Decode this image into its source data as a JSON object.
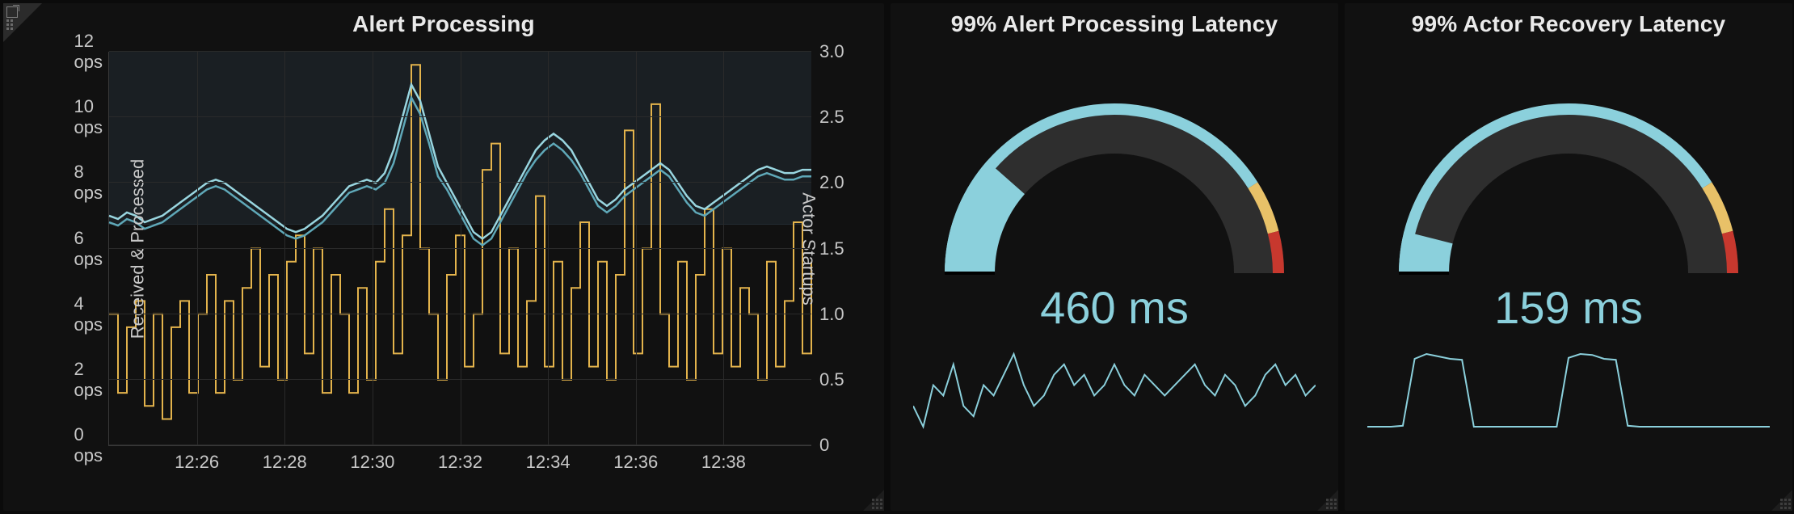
{
  "panels": {
    "alert_processing": {
      "title": "Alert Processing",
      "y_left_label": "Received & Processed",
      "y_right_label": "Actor Startups",
      "y_left_ticks": [
        "0 ops",
        "2 ops",
        "4 ops",
        "6 ops",
        "8 ops",
        "10 ops",
        "12 ops"
      ],
      "y_right_ticks": [
        "0",
        "0.5",
        "1.0",
        "1.5",
        "2.0",
        "2.5",
        "3.0"
      ],
      "x_ticks": [
        "12:26",
        "12:28",
        "12:30",
        "12:32",
        "12:34",
        "12:36",
        "12:38"
      ]
    },
    "alert_latency": {
      "title": "99% Alert Processing Latency",
      "value": "460 ms"
    },
    "recovery_latency": {
      "title": "99% Actor Recovery Latency",
      "value": "159 ms"
    }
  },
  "colors": {
    "gauge_fill": "#8bd0dc",
    "gauge_track": "#2e2e2e",
    "gauge_yellow": "#e8c168",
    "gauge_red": "#c7382e",
    "series_startups": "#e3b34c",
    "series_received": "#99d6e0",
    "series_processed": "#5fa8b8"
  },
  "chart_data": [
    {
      "type": "line",
      "title": "Alert Processing",
      "xlabel": "",
      "x_ticks": [
        "12:26",
        "12:28",
        "12:30",
        "12:32",
        "12:34",
        "12:36",
        "12:38"
      ],
      "y_left": {
        "label": "Received & Processed",
        "unit": "ops",
        "ylim": [
          0,
          12
        ]
      },
      "y_right": {
        "label": "Actor Startups",
        "ylim": [
          0,
          3.0
        ]
      },
      "x": [
        0,
        1,
        2,
        3,
        4,
        5,
        6,
        7,
        8,
        9,
        10,
        11,
        12,
        13,
        14,
        15,
        16,
        17,
        18,
        19,
        20,
        21,
        22,
        23,
        24,
        25,
        26,
        27,
        28,
        29,
        30,
        31,
        32,
        33,
        34,
        35,
        36,
        37,
        38,
        39,
        40,
        41,
        42,
        43,
        44,
        45,
        46,
        47,
        48,
        49,
        50,
        51,
        52,
        53,
        54,
        55,
        56,
        57,
        58,
        59,
        60,
        61,
        62,
        63,
        64,
        65,
        66,
        67,
        68,
        69,
        70,
        71,
        72,
        73,
        74,
        75,
        76,
        77,
        78,
        79
      ],
      "series": [
        {
          "name": "Actor Startups",
          "axis": "right",
          "color": "#e3b34c",
          "values": [
            1.0,
            0.4,
            0.9,
            1.1,
            0.3,
            1.0,
            0.2,
            0.9,
            1.1,
            0.4,
            1.0,
            1.3,
            0.4,
            1.1,
            0.5,
            1.2,
            1.5,
            0.6,
            1.3,
            0.5,
            1.4,
            1.6,
            0.7,
            1.5,
            0.4,
            1.3,
            1.0,
            0.4,
            1.2,
            0.5,
            1.4,
            1.8,
            0.7,
            1.6,
            2.9,
            1.5,
            1.0,
            0.5,
            1.3,
            1.6,
            0.6,
            1.0,
            2.1,
            2.3,
            0.7,
            1.5,
            0.6,
            1.1,
            1.9,
            0.6,
            1.4,
            0.5,
            1.2,
            1.7,
            0.6,
            1.4,
            0.5,
            1.3,
            2.4,
            0.7,
            1.5,
            2.6,
            1.0,
            0.6,
            1.4,
            0.5,
            1.3,
            1.8,
            0.7,
            1.5,
            0.6,
            1.2,
            1.0,
            0.5,
            1.4,
            0.6,
            1.1,
            1.7,
            0.7,
            1.4
          ]
        },
        {
          "name": "Received",
          "axis": "left",
          "color": "#99d6e0",
          "values": [
            7.0,
            6.9,
            7.1,
            7.0,
            6.8,
            6.9,
            7.0,
            7.2,
            7.4,
            7.6,
            7.8,
            8.0,
            8.1,
            8.0,
            7.8,
            7.6,
            7.4,
            7.2,
            7.0,
            6.8,
            6.6,
            6.5,
            6.6,
            6.8,
            7.0,
            7.3,
            7.6,
            7.9,
            8.0,
            8.1,
            8.0,
            8.3,
            9.0,
            10.0,
            11.0,
            10.5,
            9.5,
            8.5,
            8.0,
            7.5,
            7.0,
            6.5,
            6.3,
            6.5,
            7.0,
            7.5,
            8.0,
            8.5,
            9.0,
            9.3,
            9.5,
            9.3,
            9.0,
            8.5,
            8.0,
            7.5,
            7.3,
            7.5,
            7.8,
            8.0,
            8.2,
            8.4,
            8.6,
            8.4,
            8.0,
            7.6,
            7.3,
            7.2,
            7.4,
            7.6,
            7.8,
            8.0,
            8.2,
            8.4,
            8.5,
            8.4,
            8.3,
            8.3,
            8.4,
            8.4
          ]
        },
        {
          "name": "Processed",
          "axis": "left",
          "color": "#5fa8b8",
          "values": [
            6.8,
            6.7,
            6.9,
            6.8,
            6.6,
            6.7,
            6.8,
            7.0,
            7.2,
            7.4,
            7.6,
            7.8,
            7.9,
            7.8,
            7.6,
            7.4,
            7.2,
            7.0,
            6.8,
            6.6,
            6.4,
            6.3,
            6.4,
            6.6,
            6.8,
            7.1,
            7.4,
            7.7,
            7.8,
            7.9,
            7.8,
            8.0,
            8.6,
            9.6,
            10.6,
            10.1,
            9.2,
            8.2,
            7.8,
            7.3,
            6.8,
            6.3,
            6.1,
            6.3,
            6.8,
            7.3,
            7.8,
            8.3,
            8.7,
            9.0,
            9.2,
            9.0,
            8.7,
            8.3,
            7.8,
            7.3,
            7.1,
            7.3,
            7.6,
            7.8,
            8.0,
            8.2,
            8.4,
            8.2,
            7.8,
            7.4,
            7.1,
            7.0,
            7.2,
            7.4,
            7.6,
            7.8,
            8.0,
            8.2,
            8.3,
            8.2,
            8.1,
            8.1,
            8.2,
            8.2
          ]
        }
      ]
    },
    {
      "type": "gauge",
      "title": "99% Alert Processing Latency",
      "value": 460,
      "unit": "ms",
      "range": [
        0,
        2000
      ],
      "thresholds": {
        "yellow_start": 1640,
        "red_start": 1840
      },
      "sparkline": [
        450,
        440,
        460,
        455,
        470,
        450,
        445,
        460,
        455,
        465,
        475,
        460,
        450,
        455,
        465,
        470,
        460,
        465,
        455,
        460,
        470,
        460,
        455,
        465,
        460,
        455,
        460,
        465,
        470,
        460,
        455,
        465,
        460,
        450,
        455,
        465,
        470,
        460,
        465,
        455,
        460
      ]
    },
    {
      "type": "gauge",
      "title": "99% Actor Recovery Latency",
      "value": 159,
      "unit": "ms",
      "range": [
        0,
        2000
      ],
      "thresholds": {
        "yellow_start": 1640,
        "red_start": 1840
      },
      "sparkline": [
        20,
        20,
        20,
        22,
        160,
        170,
        165,
        160,
        158,
        20,
        20,
        20,
        20,
        20,
        20,
        20,
        20,
        162,
        170,
        168,
        160,
        158,
        22,
        20,
        20,
        20,
        20,
        20,
        20,
        20,
        20,
        20,
        20,
        20,
        20
      ]
    }
  ]
}
